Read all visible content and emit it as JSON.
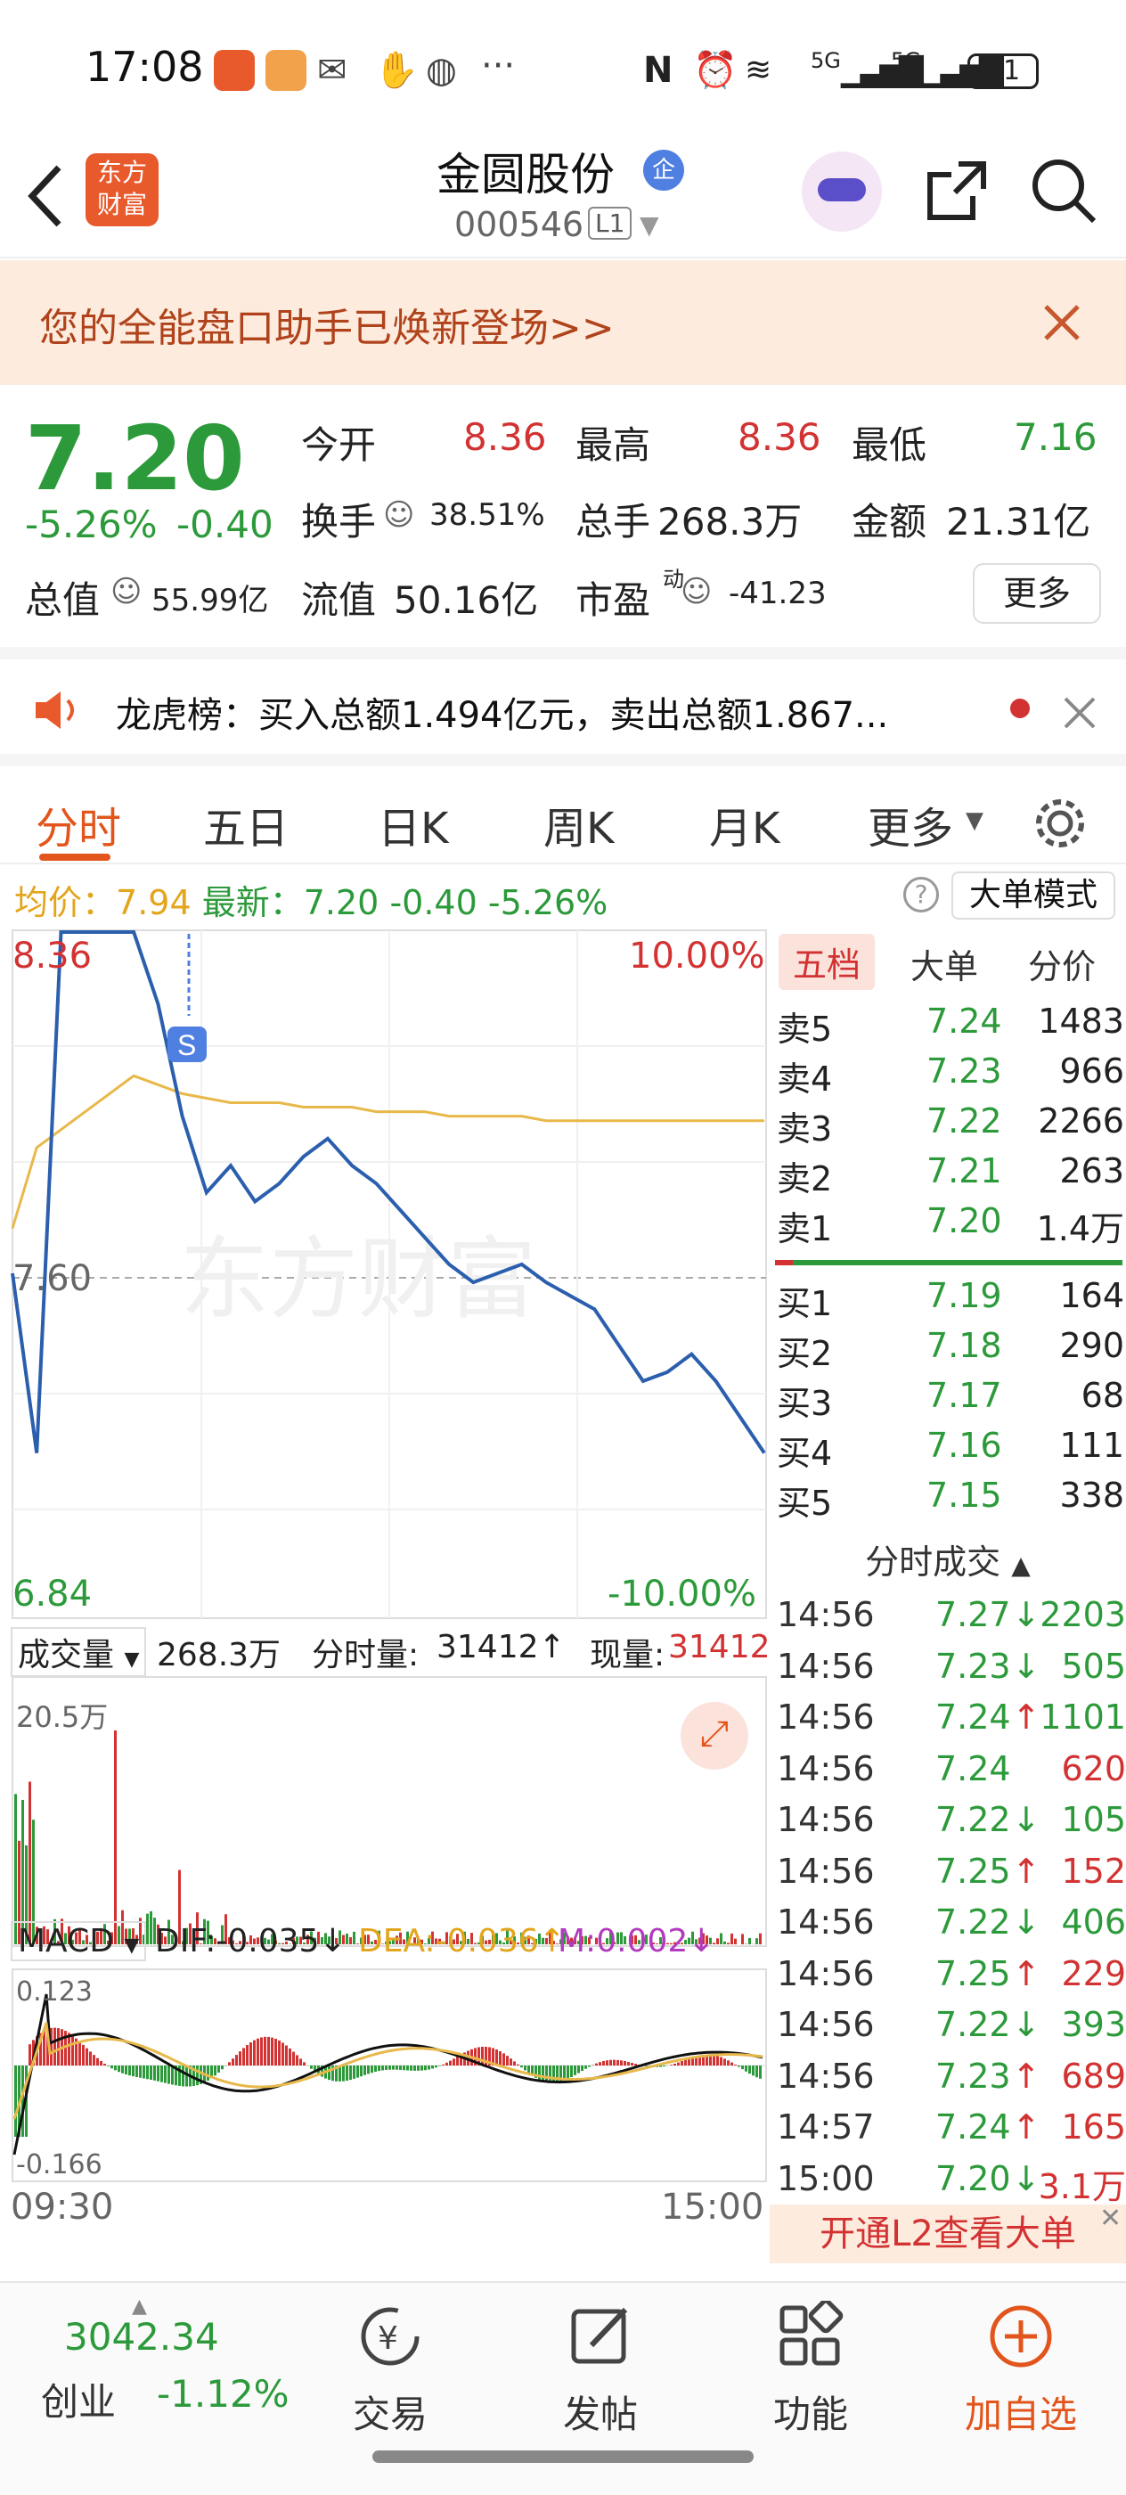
{
  "status_bar": {
    "time": "17:08",
    "battery": "41",
    "signal_1": "5G",
    "signal_2": "5G"
  },
  "header": {
    "logo_text": "东方财富",
    "stock_name": "金圆股份",
    "badge": "企",
    "stock_code": "000546",
    "level": "L1"
  },
  "banner": {
    "text": "您的全能盘口助手已焕新登场>>"
  },
  "quote": {
    "price": "7.20",
    "change_pct": "-5.26%",
    "change": "-0.40",
    "open_label": "今开",
    "open": "8.36",
    "high_label": "最高",
    "high": "8.36",
    "low_label": "最低",
    "low": "7.16",
    "turnover_label": "换手",
    "turnover": "38.51%",
    "volume_label": "总手",
    "volume": "268.3万",
    "amount_label": "金额",
    "amount": "21.31亿",
    "mktcap_label": "总值",
    "mktcap": "55.99亿",
    "float_label": "流值",
    "float": "50.16亿",
    "pe_label": "市盈",
    "pe_super": "动",
    "pe": "-41.23",
    "more": "更多"
  },
  "lhb": {
    "text": "龙虎榜：买入总额1.494亿元，卖出总额1.867..."
  },
  "tabs": [
    "分时",
    "五日",
    "日K",
    "周K",
    "月K",
    "更多"
  ],
  "avg_line": {
    "avg_label": "均价：",
    "avg": "7.94",
    "latest_label": "最新：",
    "latest": "7.20",
    "chg": "-0.40",
    "pct": "-5.26%",
    "mode_button": "大单模式"
  },
  "chart": {
    "top_price": "8.36",
    "top_pct": "10.00%",
    "mid_price": "7.60",
    "bottom_price": "6.84",
    "bottom_pct": "-10.00%",
    "s_marker": "S",
    "watermark": "东方财富",
    "volume_label": "成交量",
    "volume_total": "268.3万",
    "minute_vol_label": "分时量:",
    "minute_vol": "31412↑",
    "now_vol_label": "现量:",
    "now_vol": "31412",
    "vol_max": "20.5万",
    "macd_label": "MACD",
    "dif": "DIF:-0.035↓",
    "dea": "DEA:-0.036↑",
    "m": "M:0.002↓",
    "macd_top": "0.123",
    "macd_bottom": "-0.166",
    "time_start": "09:30",
    "time_end": "15:00"
  },
  "chart_data": {
    "type": "line",
    "price_range": [
      6.84,
      8.36
    ],
    "prev_close": 7.6,
    "price_series": [
      7.6,
      7.2,
      8.36,
      8.36,
      8.36,
      8.36,
      8.2,
      7.95,
      7.78,
      7.84,
      7.76,
      7.8,
      7.86,
      7.9,
      7.84,
      7.8,
      7.74,
      7.68,
      7.62,
      7.58,
      7.6,
      7.62,
      7.58,
      7.55,
      7.52,
      7.44,
      7.36,
      7.38,
      7.42,
      7.36,
      7.28,
      7.2
    ],
    "avg_series": [
      7.7,
      7.88,
      7.92,
      7.96,
      8.0,
      8.04,
      8.02,
      8.0,
      7.99,
      7.98,
      7.98,
      7.98,
      7.97,
      7.97,
      7.97,
      7.96,
      7.96,
      7.96,
      7.95,
      7.95,
      7.95,
      7.95,
      7.94,
      7.94,
      7.94,
      7.94,
      7.94,
      7.94,
      7.94,
      7.94,
      7.94,
      7.94
    ]
  },
  "order_book": {
    "tabs": [
      "五档",
      "大单",
      "分价"
    ],
    "asks": [
      {
        "label": "卖5",
        "price": "7.24",
        "vol": "1483"
      },
      {
        "label": "卖4",
        "price": "7.23",
        "vol": "966"
      },
      {
        "label": "卖3",
        "price": "7.22",
        "vol": "2266"
      },
      {
        "label": "卖2",
        "price": "7.21",
        "vol": "263"
      },
      {
        "label": "卖1",
        "price": "7.20",
        "vol": "1.4万"
      }
    ],
    "bids": [
      {
        "label": "买1",
        "price": "7.19",
        "vol": "164"
      },
      {
        "label": "买2",
        "price": "7.18",
        "vol": "290"
      },
      {
        "label": "买3",
        "price": "7.17",
        "vol": "68"
      },
      {
        "label": "买4",
        "price": "7.16",
        "vol": "111"
      },
      {
        "label": "买5",
        "price": "7.15",
        "vol": "338"
      }
    ],
    "trades_title": "分时成交",
    "trades": [
      {
        "time": "14:56",
        "price": "7.27",
        "dir": "↓",
        "vol": "2203",
        "color": "green"
      },
      {
        "time": "14:56",
        "price": "7.23",
        "dir": "↓",
        "vol": "505",
        "color": "green"
      },
      {
        "time": "14:56",
        "price": "7.24",
        "dir": "↑",
        "vol": "1101",
        "color": "green"
      },
      {
        "time": "14:56",
        "price": "7.24",
        "dir": "",
        "vol": "620",
        "color": "red"
      },
      {
        "time": "14:56",
        "price": "7.22",
        "dir": "↓",
        "vol": "105",
        "color": "green"
      },
      {
        "time": "14:56",
        "price": "7.25",
        "dir": "↑",
        "vol": "152",
        "color": "red"
      },
      {
        "time": "14:56",
        "price": "7.22",
        "dir": "↓",
        "vol": "406",
        "color": "green"
      },
      {
        "time": "14:56",
        "price": "7.25",
        "dir": "↑",
        "vol": "229",
        "color": "red"
      },
      {
        "time": "14:56",
        "price": "7.22",
        "dir": "↓",
        "vol": "393",
        "color": "green"
      },
      {
        "time": "14:56",
        "price": "7.23",
        "dir": "↑",
        "vol": "689",
        "color": "red"
      },
      {
        "time": "14:57",
        "price": "7.24",
        "dir": "↑",
        "vol": "165",
        "color": "red"
      },
      {
        "time": "15:00",
        "price": "7.20",
        "dir": "↓",
        "vol": "3.1万",
        "color": "red"
      }
    ],
    "l2_button": "开通L2查看大单"
  },
  "bottom_nav": {
    "index_value": "3042.34",
    "index_name": "创业",
    "index_pct": "-1.12%",
    "items": [
      "交易",
      "发帖",
      "功能",
      "加自选"
    ]
  }
}
